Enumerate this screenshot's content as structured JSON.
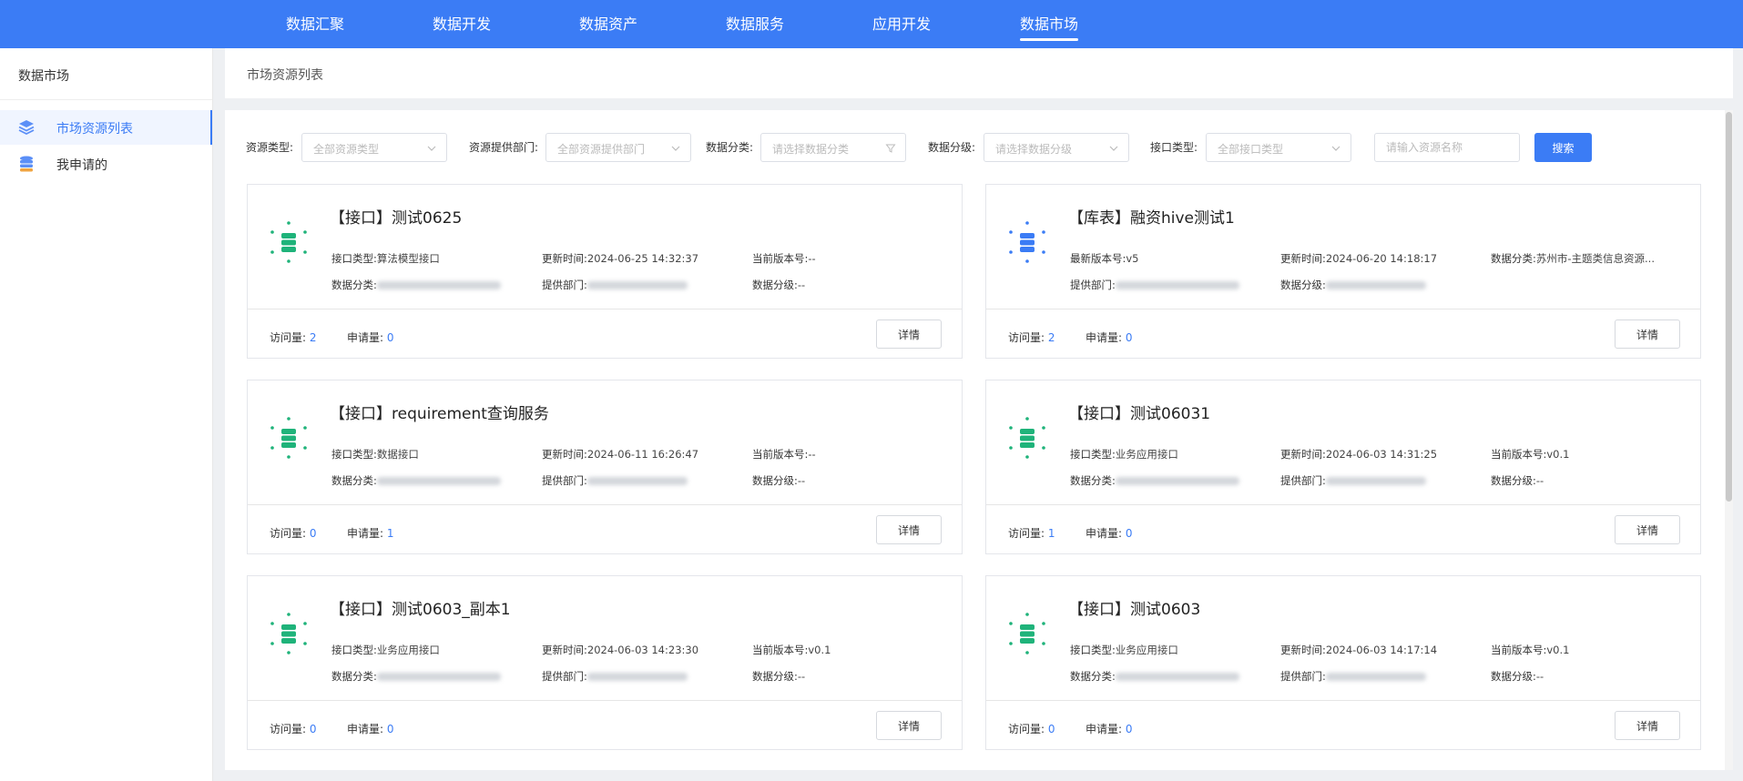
{
  "nav": {
    "items": [
      {
        "label": "数据汇聚"
      },
      {
        "label": "数据开发"
      },
      {
        "label": "数据资产"
      },
      {
        "label": "数据服务"
      },
      {
        "label": "应用开发"
      },
      {
        "label": "数据市场",
        "active": true
      }
    ]
  },
  "sidebar": {
    "title": "数据市场",
    "items": [
      {
        "label": "市场资源列表",
        "icon": "layers-icon",
        "active": true
      },
      {
        "label": "我申请的",
        "icon": "database-stack-icon"
      }
    ]
  },
  "breadcrumb": "市场资源列表",
  "filters": {
    "resource_type": {
      "label": "资源类型:",
      "placeholder": "全部资源类型"
    },
    "provider_dept": {
      "label": "资源提供部门:",
      "placeholder": "全部资源提供部门"
    },
    "category": {
      "label": "数据分类:",
      "placeholder": "请选择数据分类"
    },
    "level": {
      "label": "数据分级:",
      "placeholder": "请选择数据分级"
    },
    "api_type": {
      "label": "接口类型:",
      "placeholder": "全部接口类型"
    },
    "name_placeholder": "请输入资源名称",
    "search_label": "搜索"
  },
  "colors": {
    "primary": "#3b7cf5",
    "icon_green": "#1fb37a",
    "icon_blue": "#3b7cf5"
  },
  "cards": [
    {
      "title": "【接口】测试0625",
      "icon_color": "green",
      "row1": [
        {
          "k": "接口类型:",
          "v": "算法模型接口"
        },
        {
          "k": "更新时间:",
          "v": "2024-06-25 14:32:37"
        },
        {
          "k": "当前版本号:",
          "v": "--"
        }
      ],
      "row2": [
        {
          "k": "数据分类:",
          "v": "",
          "blur": true
        },
        {
          "k": "提供部门:",
          "v": "",
          "blur": true
        },
        {
          "k": "数据分级:",
          "v": "--"
        }
      ],
      "visits_label": "访问量:",
      "visits": "2",
      "applies_label": "申请量:",
      "applies": "0",
      "detail_label": "详情"
    },
    {
      "title": "【库表】融资hive测试1",
      "icon_color": "blue",
      "row1": [
        {
          "k": "最新版本号:",
          "v": "v5"
        },
        {
          "k": "更新时间:",
          "v": "2024-06-20 14:18:17"
        },
        {
          "k": "数据分类:",
          "v": "苏州市-主题类信息资源..."
        }
      ],
      "row2": [
        {
          "k": "提供部门:",
          "v": "",
          "blur": true
        },
        {
          "k": "数据分级:",
          "v": "",
          "blur": true
        },
        {
          "k": "",
          "v": ""
        }
      ],
      "visits_label": "访问量:",
      "visits": "2",
      "applies_label": "申请量:",
      "applies": "0",
      "detail_label": "详情"
    },
    {
      "title": "【接口】requirement查询服务",
      "icon_color": "green",
      "row1": [
        {
          "k": "接口类型:",
          "v": "数据接口"
        },
        {
          "k": "更新时间:",
          "v": "2024-06-11 16:26:47"
        },
        {
          "k": "当前版本号:",
          "v": "--"
        }
      ],
      "row2": [
        {
          "k": "数据分类:",
          "v": "",
          "blur": true
        },
        {
          "k": "提供部门:",
          "v": "",
          "blur": true
        },
        {
          "k": "数据分级:",
          "v": "--"
        }
      ],
      "visits_label": "访问量:",
      "visits": "0",
      "applies_label": "申请量:",
      "applies": "1",
      "detail_label": "详情"
    },
    {
      "title": "【接口】测试06031",
      "icon_color": "green",
      "row1": [
        {
          "k": "接口类型:",
          "v": "业务应用接口"
        },
        {
          "k": "更新时间:",
          "v": "2024-06-03 14:31:25"
        },
        {
          "k": "当前版本号:",
          "v": "v0.1"
        }
      ],
      "row2": [
        {
          "k": "数据分类:",
          "v": "",
          "blur": true
        },
        {
          "k": "提供部门:",
          "v": "",
          "blur": true
        },
        {
          "k": "数据分级:",
          "v": "--"
        }
      ],
      "visits_label": "访问量:",
      "visits": "1",
      "applies_label": "申请量:",
      "applies": "0",
      "detail_label": "详情"
    },
    {
      "title": "【接口】测试0603_副本1",
      "icon_color": "green",
      "row1": [
        {
          "k": "接口类型:",
          "v": "业务应用接口"
        },
        {
          "k": "更新时间:",
          "v": "2024-06-03 14:23:30"
        },
        {
          "k": "当前版本号:",
          "v": "v0.1"
        }
      ],
      "row2": [
        {
          "k": "数据分类:",
          "v": "",
          "blur": true
        },
        {
          "k": "提供部门:",
          "v": "",
          "blur": true
        },
        {
          "k": "数据分级:",
          "v": "--"
        }
      ],
      "visits_label": "访问量:",
      "visits": "0",
      "applies_label": "申请量:",
      "applies": "0",
      "detail_label": "详情"
    },
    {
      "title": "【接口】测试0603",
      "icon_color": "green",
      "row1": [
        {
          "k": "接口类型:",
          "v": "业务应用接口"
        },
        {
          "k": "更新时间:",
          "v": "2024-06-03 14:17:14"
        },
        {
          "k": "当前版本号:",
          "v": "v0.1"
        }
      ],
      "row2": [
        {
          "k": "数据分类:",
          "v": "",
          "blur": true
        },
        {
          "k": "提供部门:",
          "v": "",
          "blur": true
        },
        {
          "k": "数据分级:",
          "v": "--"
        }
      ],
      "visits_label": "访问量:",
      "visits": "0",
      "applies_label": "申请量:",
      "applies": "0",
      "detail_label": "详情"
    }
  ]
}
